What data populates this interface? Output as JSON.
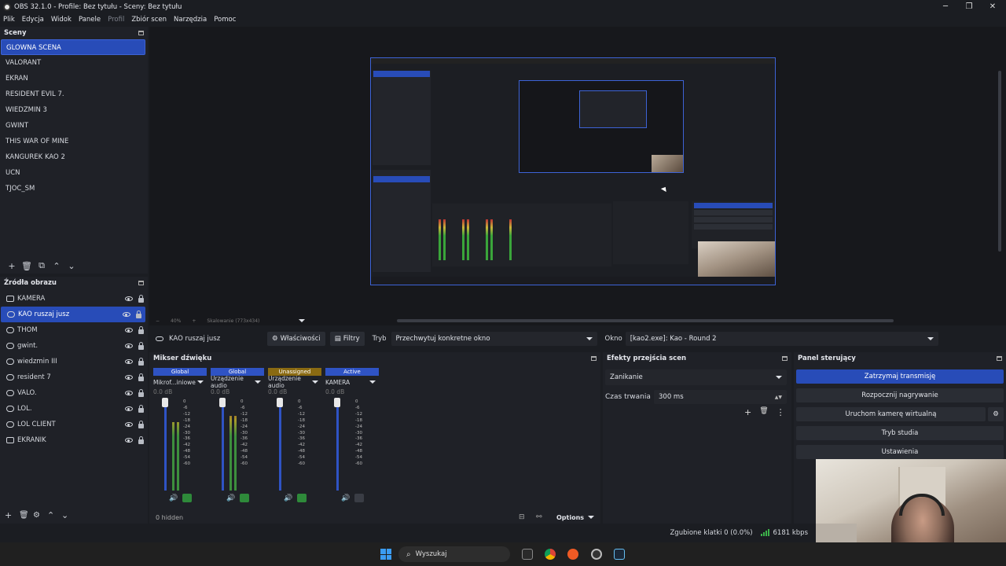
{
  "window": {
    "title": "OBS 32.1.0 - Profile: Bez tytułu - Sceny: Bez tytułu",
    "minimize": "─",
    "maximize": "❐",
    "close": "✕"
  },
  "menu": [
    {
      "label": "Plik"
    },
    {
      "label": "Edycja"
    },
    {
      "label": "Widok"
    },
    {
      "label": "Panele"
    },
    {
      "label": "Profil",
      "disabled": true
    },
    {
      "label": "Zbiór scen"
    },
    {
      "label": "Narzędzia"
    },
    {
      "label": "Pomoc"
    }
  ],
  "scenes": {
    "title": "Sceny",
    "items": [
      {
        "label": "GLOWNA SCENA"
      },
      {
        "label": "VALORANT"
      },
      {
        "label": "EKRAN"
      },
      {
        "label": "RESIDENT EVIL 7."
      },
      {
        "label": "WIEDZMIN 3"
      },
      {
        "label": "GWINT"
      },
      {
        "label": "THIS WAR OF MINE"
      },
      {
        "label": "KANGUREK KAO 2"
      },
      {
        "label": "UCN"
      },
      {
        "label": "TJOC_SM"
      }
    ],
    "selected_index": 0
  },
  "sources": {
    "title": "Źródła obrazu",
    "items": [
      {
        "label": "KAMERA"
      },
      {
        "label": "KAO ruszaj jusz"
      },
      {
        "label": "THOM"
      },
      {
        "label": "gwint."
      },
      {
        "label": "wiedzmin III"
      },
      {
        "label": "resident 7"
      },
      {
        "label": "VALO."
      },
      {
        "label": "LOL."
      },
      {
        "label": "LOL CLIENT"
      },
      {
        "label": "EKRANIK"
      }
    ],
    "selected_index": 1
  },
  "toolbar_icons": {
    "add": "+",
    "remove": "🗑",
    "filter": "⧉",
    "settings": "⚙",
    "up": "⌃",
    "down": "⌄"
  },
  "context_bar": {
    "source_name": "KAO ruszaj jusz",
    "properties_label": "Właściwości",
    "filters_label": "Filtry",
    "mode_label": "Tryb",
    "mode_value": "Przechwytuj konkretne okno",
    "window_label": "Okno",
    "window_value": "[kao2.exe]: Kao - Round 2"
  },
  "mixer": {
    "title": "Mikser dźwięku",
    "channels": [
      {
        "tag": "Global",
        "tag_color": "#2f53c4",
        "name": "Mikrof...iniowe",
        "db": "0.0 dB",
        "level": 0.78,
        "muted_headphones": false
      },
      {
        "tag": "Global",
        "tag_color": "#2f53c4",
        "name": "Urządzenie audio",
        "db": "0.0 dB",
        "level": 0.85,
        "muted_headphones": false
      },
      {
        "tag": "Unassigned",
        "tag_color": "#8a6a12",
        "name": "Urządzenie audio",
        "db": "0.0 dB",
        "level": 0.0,
        "muted_headphones": false
      },
      {
        "tag": "Active",
        "tag_color": "#2f53c4",
        "name": "KAMERA",
        "db": "0.0 dB",
        "level": 0.0,
        "muted_headphones": true
      }
    ],
    "scale": [
      "0",
      "-6",
      "-12",
      "-18",
      "-24",
      "-30",
      "-36",
      "-42",
      "-48",
      "-54",
      "-60"
    ],
    "hidden": "0 hidden",
    "options_label": "Options"
  },
  "transitions": {
    "title": "Efekty przejścia scen",
    "type": "Zanikanie",
    "duration_label": "Czas trwania",
    "duration_value": "300 ms"
  },
  "controls": {
    "title": "Panel sterujący",
    "buttons": [
      {
        "label": "Zatrzymaj transmisję",
        "active": true
      },
      {
        "label": "Rozpocznij nagrywanie",
        "active": false
      },
      {
        "label": "Uruchom kamerę wirtualną",
        "active": false
      },
      {
        "label": "Tryb studia",
        "active": false
      },
      {
        "label": "Ustawienia",
        "active": false
      }
    ]
  },
  "preview": {
    "zoom": "40%",
    "scale_text": "Skalowanie (773x434)"
  },
  "status": {
    "dropped": "Zgubione klatki 0 (0.0%)",
    "bitrate": "6181 kbps"
  },
  "taskbar": {
    "search_placeholder": "Wyszukaj"
  },
  "colors": {
    "accent": "#284cb8",
    "panel": "#1f2127",
    "background": "#1b1d22"
  }
}
